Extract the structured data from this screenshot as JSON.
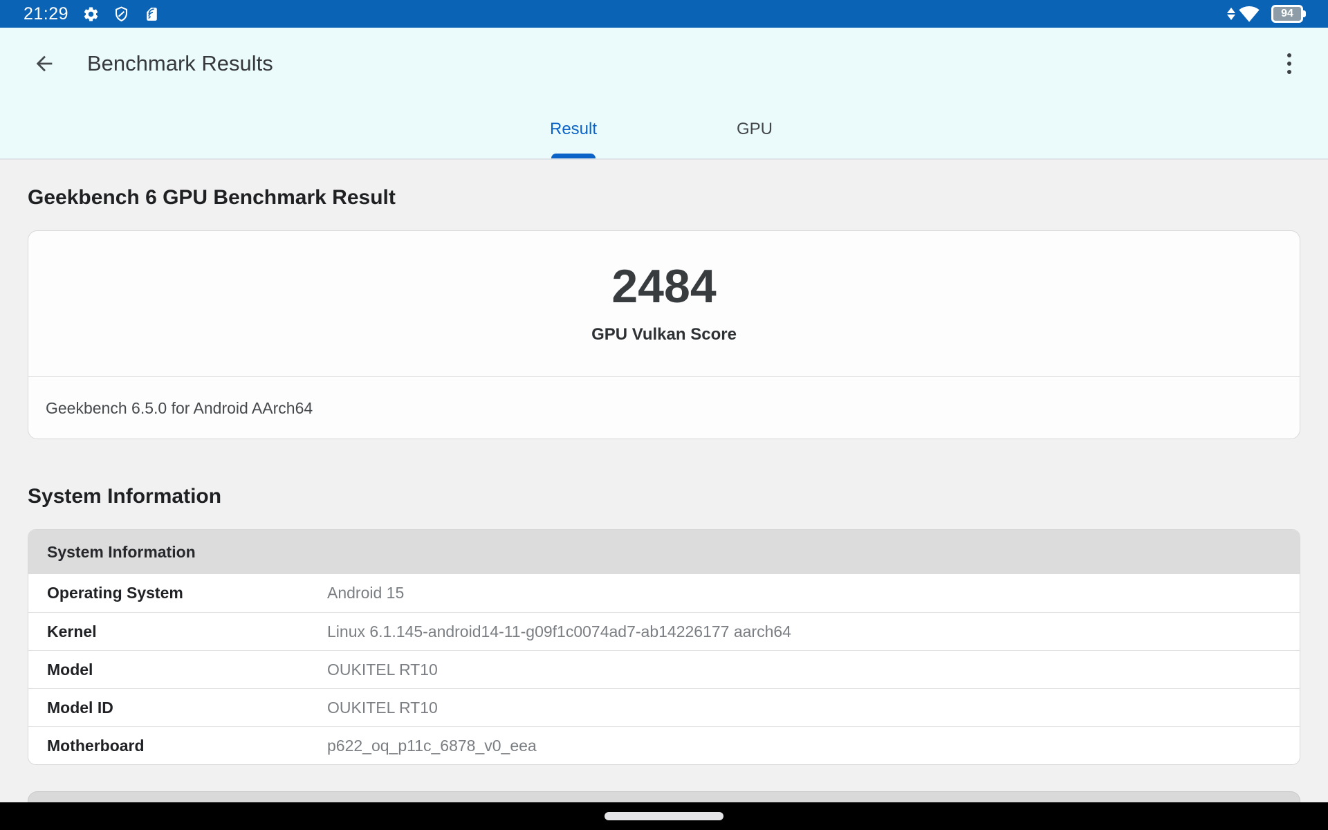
{
  "status_bar": {
    "time": "21:29",
    "battery_percent": "94"
  },
  "app_bar": {
    "title": "Benchmark Results"
  },
  "tabs": [
    {
      "label": "Result",
      "active": true
    },
    {
      "label": "GPU",
      "active": false
    }
  ],
  "result_section": {
    "heading": "Geekbench 6 GPU Benchmark Result",
    "score": "2484",
    "score_label": "GPU Vulkan Score",
    "app_version": "Geekbench 6.5.0 for Android AArch64"
  },
  "system_info": {
    "heading": "System Information",
    "table_header": "System Information",
    "rows": [
      {
        "label": "Operating System",
        "value": "Android 15"
      },
      {
        "label": "Kernel",
        "value": "Linux 6.1.145-android14-11-g09f1c0074ad7-ab14226177 aarch64"
      },
      {
        "label": "Model",
        "value": "OUKITEL RT10"
      },
      {
        "label": "Model ID",
        "value": "OUKITEL RT10"
      },
      {
        "label": "Motherboard",
        "value": "p622_oq_p11c_6878_v0_eea"
      }
    ]
  },
  "colors": {
    "status_bar": "#0A63B5",
    "header_background": "#EBFBFC",
    "accent_blue": "#0B63C8",
    "content_background": "#F1F1F1",
    "table_header_gray": "#DCDCDC"
  }
}
